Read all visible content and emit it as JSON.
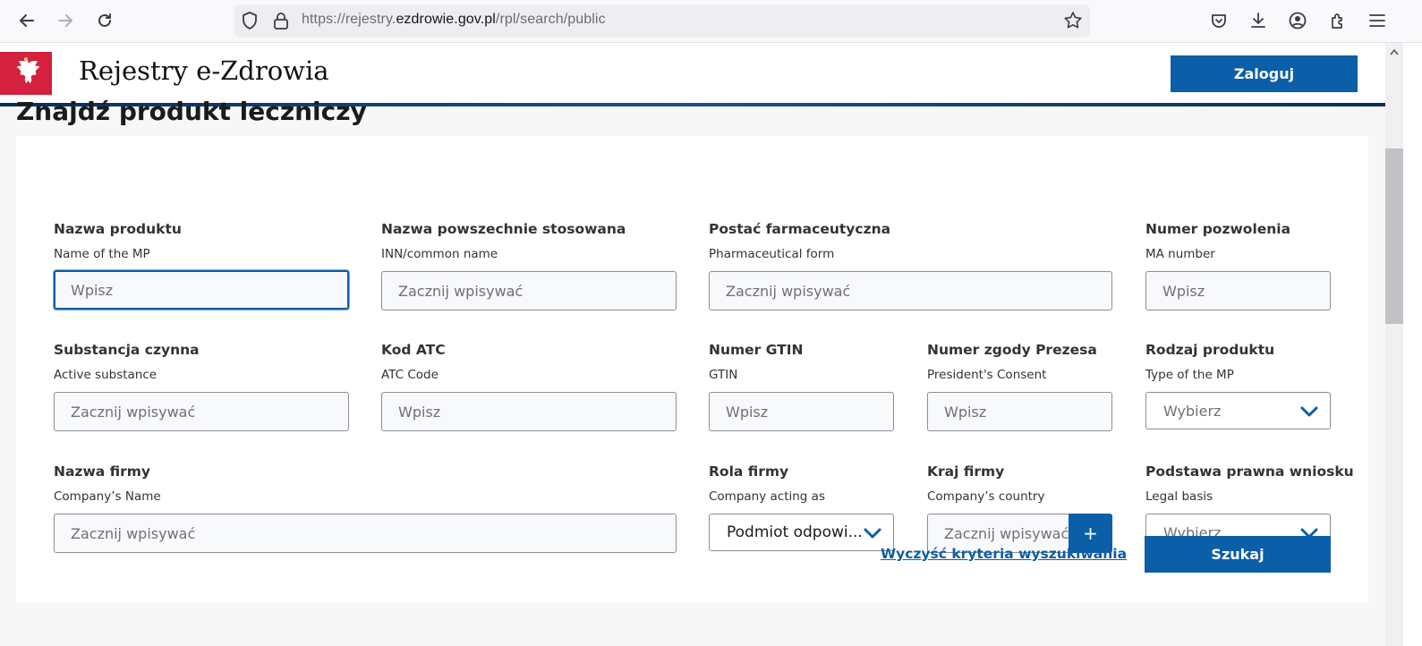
{
  "browser": {
    "url_prefix": "https://rejestry.",
    "url_domain": "ezdrowie.gov.pl",
    "url_path": "/rpl/search/public"
  },
  "header": {
    "site_title": "Rejestry e-Zdrowia",
    "login_label": "Zaloguj"
  },
  "page_title": "Znajdź produkt leczniczy",
  "form": {
    "product_name": {
      "label": "Nazwa produktu",
      "sub": "Name of the MP",
      "placeholder": "Wpisz"
    },
    "common_name": {
      "label": "Nazwa powszechnie stosowana",
      "sub": "INN/common name",
      "placeholder": "Zacznij wpisywać"
    },
    "pharma_form": {
      "label": "Postać farmaceutyczna",
      "sub": "Pharmaceutical form",
      "placeholder": "Zacznij wpisywać"
    },
    "ma_number": {
      "label": "Numer pozwolenia",
      "sub": "MA number",
      "placeholder": "Wpisz"
    },
    "active_substance": {
      "label": "Substancja czynna",
      "sub": "Active substance",
      "placeholder": "Zacznij wpisywać"
    },
    "atc_code": {
      "label": "Kod ATC",
      "sub": "ATC Code",
      "placeholder": "Wpisz"
    },
    "gtin": {
      "label": "Numer GTIN",
      "sub": "GTIN",
      "placeholder": "Wpisz"
    },
    "president_consent": {
      "label": "Numer zgody Prezesa",
      "sub": "President's Consent",
      "placeholder": "Wpisz"
    },
    "product_type": {
      "label": "Rodzaj produktu",
      "sub": "Type of the MP",
      "value": "Wybierz"
    },
    "company_name": {
      "label": "Nazwa firmy",
      "sub": "Company’s Name",
      "placeholder": "Zacznij wpisywać"
    },
    "company_role": {
      "label": "Rola firmy",
      "sub": "Company acting as",
      "value": "Podmiot odpowi..."
    },
    "company_country": {
      "label": "Kraj firmy",
      "sub": "Company’s country",
      "placeholder": "Zacznij wpisywać",
      "add_label": "+"
    },
    "legal_basis": {
      "label": "Podstawa prawna wniosku",
      "sub": "Legal basis",
      "value": "Wybierz..."
    }
  },
  "actions": {
    "clear_label": "Wyczyść kryteria wyszukiwania",
    "search_label": "Szukaj"
  },
  "colors": {
    "primary": "#0b5ea8",
    "logo_red": "#d4213d",
    "header_line": "#0b2e59"
  }
}
